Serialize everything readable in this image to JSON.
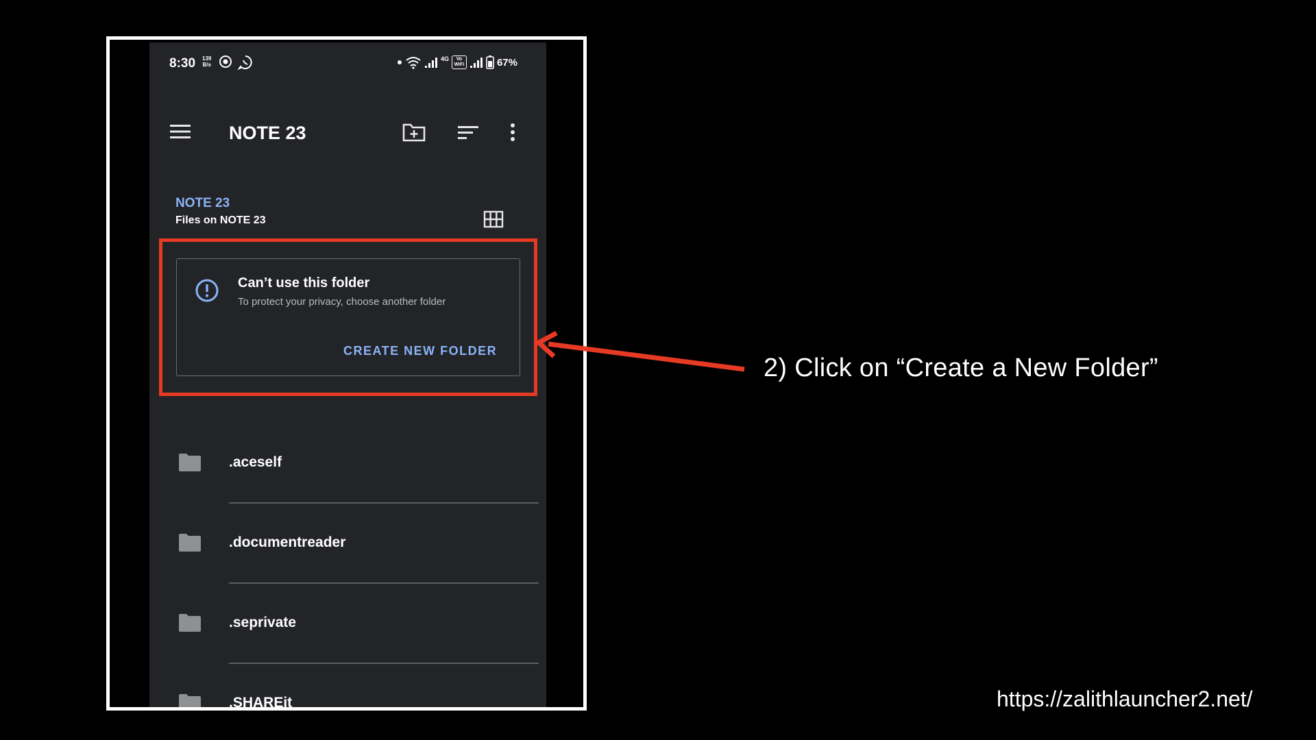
{
  "status_bar": {
    "time": "8:30",
    "net_speed_value": "139",
    "net_speed_unit": "B/s",
    "volte_label": "Vo WiFi",
    "network_label": "4G",
    "battery": "67%"
  },
  "app_bar": {
    "title": "NOTE 23",
    "icons": [
      "menu-icon",
      "new-folder-icon",
      "sort-icon",
      "more-vert-icon"
    ]
  },
  "breadcrumb": "NOTE 23",
  "section": {
    "header": "Files on NOTE 23",
    "view_icon": "grid-view-icon"
  },
  "warning_card": {
    "title": "Can’t use this folder",
    "subtitle": "To protect your privacy, choose another folder",
    "action": "CREATE NEW FOLDER",
    "icon": "info-circle-icon"
  },
  "folders": [
    {
      "name": ".aceself"
    },
    {
      "name": ".documentreader"
    },
    {
      "name": ".seprivate"
    },
    {
      "name": ".SHAREit"
    }
  ],
  "annotation": {
    "instruction": "2) Click on “Create a New Folder”",
    "highlight_color": "#e63a24"
  },
  "watermark": "https://zalithlauncher2.net/",
  "colors": {
    "background": "#000000",
    "phone_bg": "#232427",
    "accent_blue": "#8ab4f8",
    "highlight_red": "#e63a24"
  }
}
